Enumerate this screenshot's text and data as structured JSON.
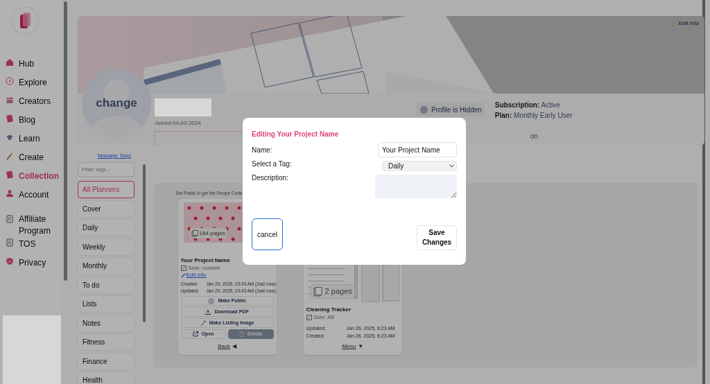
{
  "sidebar": {
    "items": [
      {
        "label": "Hub",
        "selected": false
      },
      {
        "label": "Explore",
        "selected": false
      },
      {
        "label": "Creators",
        "selected": false
      },
      {
        "label": "Blog",
        "selected": false
      },
      {
        "label": "Learn",
        "selected": false
      },
      {
        "label": "Create",
        "selected": false
      },
      {
        "label": "Collection",
        "selected": true
      },
      {
        "label": "Account",
        "selected": false
      },
      {
        "label": "Affiliate Program",
        "selected": false
      },
      {
        "label": "TOS",
        "selected": false
      },
      {
        "label": "Privacy",
        "selected": false
      }
    ]
  },
  "profile": {
    "edit_button": "Edit Info",
    "avatar_label": "change",
    "joined": "Joined 04-03-2024",
    "visibility": {
      "label": "Profile is Hidden",
      "on": false
    },
    "subscription": {
      "label": "Subscription:",
      "value": "Active"
    },
    "plan": {
      "label": "Plan:",
      "value": "Monthly Early User"
    },
    "line_3": "on"
  },
  "tags": {
    "manage_link": "Manage Tags",
    "filter": {
      "placeholder": "Filter tags..."
    },
    "items": [
      {
        "label": "All Planners",
        "selected": true
      },
      {
        "label": "Cover",
        "selected": false
      },
      {
        "label": "Daily",
        "selected": false
      },
      {
        "label": "Weekly",
        "selected": false
      },
      {
        "label": "Monthly",
        "selected": false
      },
      {
        "label": "To do",
        "selected": false
      },
      {
        "label": "Lists",
        "selected": false
      },
      {
        "label": "Notes",
        "selected": false
      },
      {
        "label": "Fitness",
        "selected": false
      },
      {
        "label": "Finance",
        "selected": false
      },
      {
        "label": "Health",
        "selected": false
      }
    ]
  },
  "hint": "Set Public to get the Recipe Code",
  "projects": [
    {
      "kind": "expanded",
      "pages": "184 pages",
      "title": "Your Project Name",
      "size": "Size: custom",
      "edit_link": "Edit info",
      "dates": [
        {
          "label": "Created:",
          "value": "Jan 29, 2025, 10:43 AM (Just now)"
        },
        {
          "label": "Updated:",
          "value": "Jan 29, 2025, 10:43 AM (Just now)"
        }
      ],
      "public": {
        "label": "Make Public",
        "on": false
      },
      "download": "Download PDF",
      "listing": "Make Listing Image",
      "open": "Open",
      "delete": {
        "label": "Delete",
        "disabled": true
      },
      "toggle": {
        "label": "Back",
        "arrow": "◀"
      }
    },
    {
      "kind": "collapsed",
      "pages": "2 pages",
      "title": "Cleaning Tracker",
      "size": "Size: A5",
      "dates": [
        {
          "label": "Updated:",
          "value": "Jan 26, 2025, 6:23 AM"
        },
        {
          "label": "Created:",
          "value": "Jan 26, 2025, 6:23 AM"
        }
      ],
      "toggle": {
        "label": "Menu",
        "arrow": "▼"
      }
    }
  ],
  "modal": {
    "title": "Editing Your Project Name",
    "fields": [
      {
        "kind": "text",
        "label": "Name:",
        "value": "Your Project Name"
      },
      {
        "kind": "select",
        "label": "Select a Tag:",
        "value": "Daily"
      },
      {
        "kind": "textarea",
        "label": "Description:"
      }
    ],
    "cancel": "cancel",
    "save": "Save Changes"
  }
}
